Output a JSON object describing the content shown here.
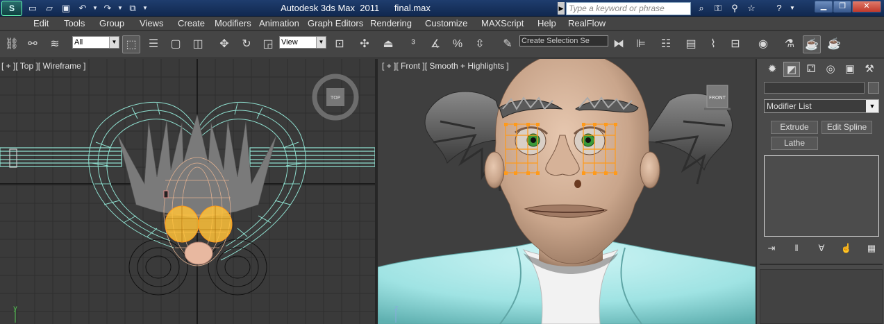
{
  "titlebar": {
    "app_logo": "S",
    "title": "Autodesk 3ds Max  2011",
    "file_name": "final.max",
    "search_placeholder": "Type a keyword or phrase"
  },
  "menu": [
    "Edit",
    "Tools",
    "Group",
    "Views",
    "Create",
    "Modifiers",
    "Animation",
    "Graph Editors",
    "Rendering",
    "Customize",
    "MAXScript",
    "Help",
    "RealFlow"
  ],
  "toolbar": {
    "selection_filter": "All",
    "reference_coord": "View",
    "named_selection_placeholder": "Create Selection Se"
  },
  "viewports": {
    "left": {
      "label": "[ + ][ Top ][ Wireframe ]",
      "viewcube_label": "TOP"
    },
    "right": {
      "label": "[ + ][ Front ][ Smooth + Highlights ]",
      "viewcube_label": "FRONT"
    }
  },
  "command_panel": {
    "modifier_list": "Modifier List",
    "buttons": [
      "Extrude",
      "Edit Spline",
      "Lathe"
    ]
  },
  "colors": {
    "wire_cyan": "#8fe0d0",
    "selection_orange": "#ff9a1a",
    "skin": "#c9a58b",
    "shirt": "#9fe3e3"
  }
}
